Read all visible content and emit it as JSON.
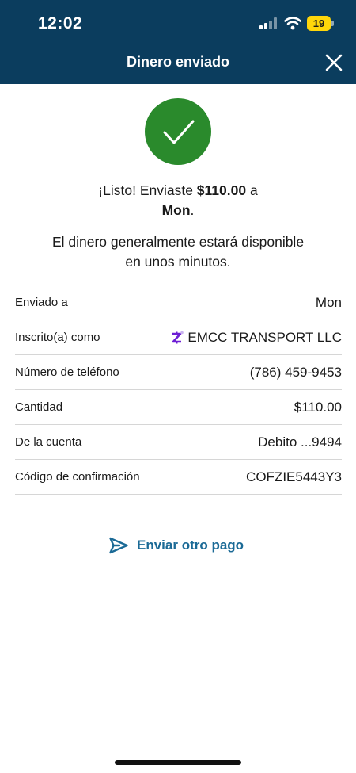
{
  "status_bar": {
    "time": "12:02",
    "battery_level": "19",
    "battery_color": "#ffd60a"
  },
  "header": {
    "title": "Dinero enviado",
    "background_color": "#0b3d5e",
    "close_icon": "close-icon"
  },
  "confirmation": {
    "icon": "checkmark-icon",
    "icon_color": "#2a8a2c",
    "prefix": "¡Listo! Enviaste ",
    "amount": "$110.00",
    "middle": " a",
    "recipient": "Mon",
    "suffix": ".",
    "availability_line1": "El dinero generalmente estará disponible",
    "availability_line2": "en unos minutos."
  },
  "details": [
    {
      "label": "Enviado a",
      "value": "Mon"
    },
    {
      "label": "Inscrito(a) como",
      "value": "EMCC TRANSPORT LLC",
      "icon": "zelle-icon"
    },
    {
      "label": "Número de teléfono",
      "value": "(786) 459-9453"
    },
    {
      "label": "Cantidad",
      "value": "$110.00"
    },
    {
      "label": "De la cuenta",
      "value": "Debito ...9494"
    },
    {
      "label": "Código de confirmación",
      "value": "COFZIE5443Y3"
    }
  ],
  "actions": {
    "send_again_label": "Enviar otro pago",
    "send_again_icon": "send-icon",
    "accent_color": "#1b6a96"
  }
}
